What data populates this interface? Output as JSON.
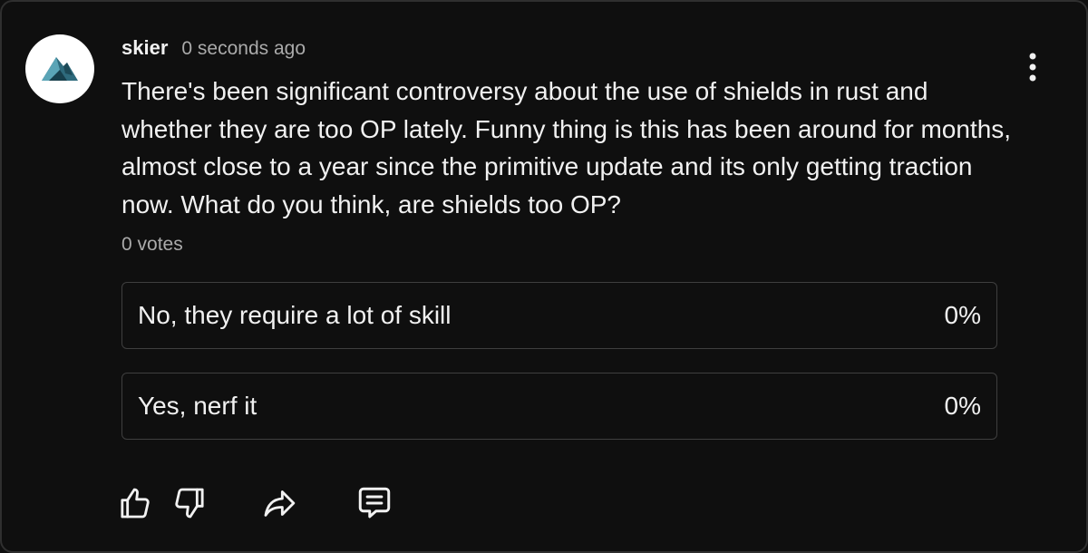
{
  "post": {
    "author": "skier",
    "time": "0 seconds ago",
    "text": "There's been significant controversy about the use of shields in rust and whether they are too OP lately. Funny thing is this has been around for months, almost close to a year since the primitive update and its only getting traction now. What do you think, are shields too OP?",
    "votes": "0 votes"
  },
  "poll": {
    "options": [
      {
        "label": "No, they require a lot of skill",
        "percent": "0%"
      },
      {
        "label": "Yes, nerf it",
        "percent": "0%"
      }
    ]
  },
  "icons": {
    "avatar": "mountain-logo",
    "menu": "kebab-menu-icon",
    "like": "thumbs-up-icon",
    "dislike": "thumbs-down-icon",
    "share": "share-arrow-icon",
    "reply": "comment-icon"
  },
  "colors": {
    "background": "#0f0f0f",
    "border": "#3f3f3f",
    "text": "#f1f1f1",
    "secondary_text": "#aaaaaa",
    "avatar_bg": "#ffffff",
    "avatar_logo": "#2e6a7c"
  }
}
